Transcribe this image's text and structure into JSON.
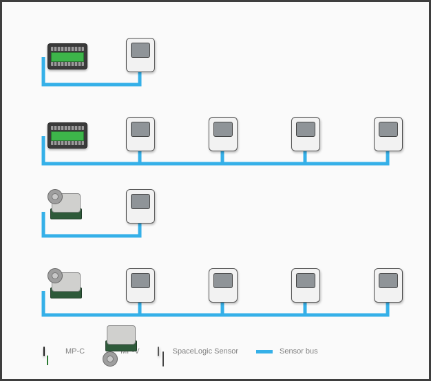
{
  "legend": {
    "mpc_label": "MP-C",
    "mpv_label": "MP-V",
    "sensor_label": "SpaceLogic Sensor",
    "bus_label": "Sensor bus"
  },
  "colors": {
    "bus": "#35B0E8",
    "frame": "#3E3E3E",
    "bg": "#FAFAFA"
  },
  "rows": [
    {
      "controller": "mpc",
      "sensors": 1
    },
    {
      "controller": "mpc",
      "sensors": 4
    },
    {
      "controller": "mpv",
      "sensors": 1
    },
    {
      "controller": "mpv",
      "sensors": 4
    }
  ]
}
